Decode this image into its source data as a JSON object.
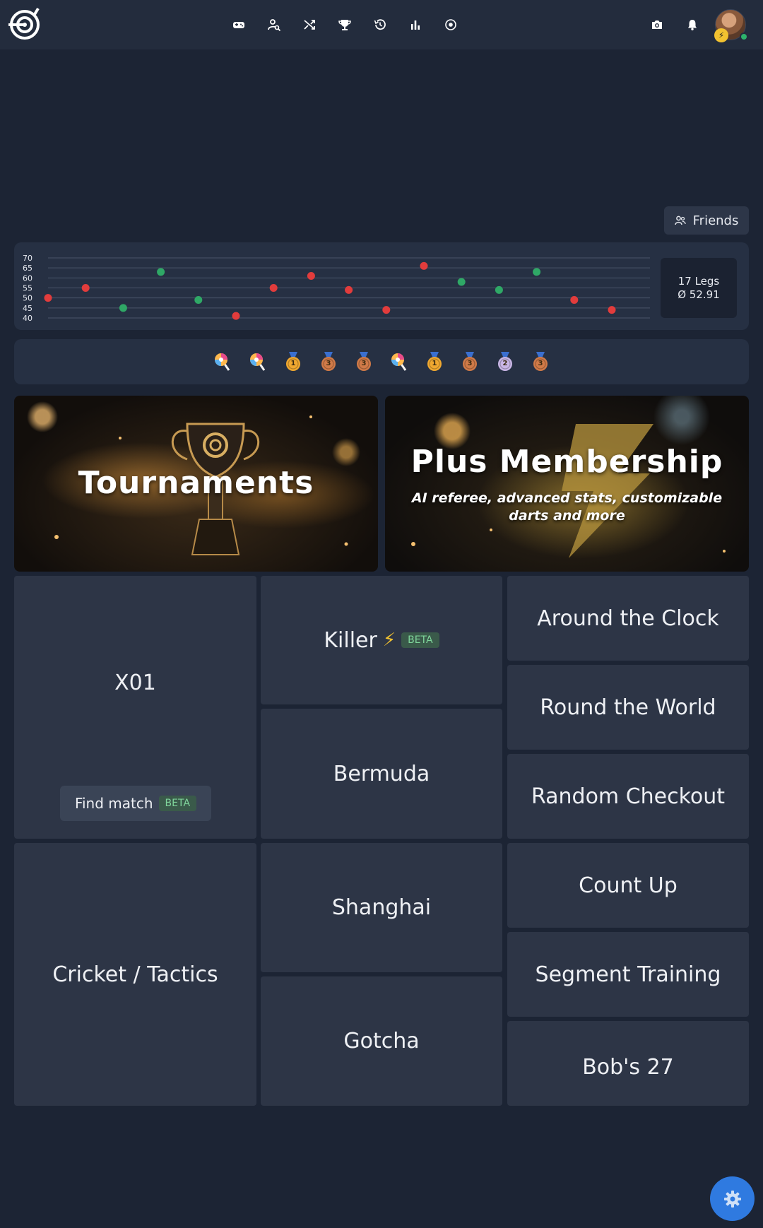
{
  "nav": {
    "icons": [
      "gamepad-icon",
      "user-search-icon",
      "shuffle-icon",
      "trophy-icon",
      "history-icon",
      "bar-chart-icon",
      "record-icon"
    ],
    "right_icons": [
      "camera-icon",
      "bell-icon"
    ]
  },
  "friends": {
    "label": "Friends"
  },
  "stats": {
    "legs": "17 Legs",
    "average": "Ø 52.91"
  },
  "chart_data": {
    "type": "scatter",
    "y_ticks": [
      "70",
      "65",
      "60",
      "55",
      "50",
      "45",
      "40"
    ],
    "ylim": [
      40,
      70
    ],
    "points": [
      {
        "y": 50,
        "result": "loss"
      },
      {
        "y": 55,
        "result": "loss"
      },
      {
        "y": 45,
        "result": "win"
      },
      {
        "y": 63,
        "result": "win"
      },
      {
        "y": 49,
        "result": "win"
      },
      {
        "y": 41,
        "result": "loss"
      },
      {
        "y": 55,
        "result": "loss"
      },
      {
        "y": 61,
        "result": "loss"
      },
      {
        "y": 54,
        "result": "loss"
      },
      {
        "y": 44,
        "result": "loss"
      },
      {
        "y": 66,
        "result": "loss"
      },
      {
        "y": 58,
        "result": "win"
      },
      {
        "y": 54,
        "result": "win"
      },
      {
        "y": 63,
        "result": "win"
      },
      {
        "y": 49,
        "result": "loss"
      },
      {
        "y": 44,
        "result": "loss"
      }
    ],
    "colors": {
      "win": "#2fa866",
      "loss": "#e23c3c"
    },
    "grid": true
  },
  "medals": [
    {
      "icon": "lollipop-icon"
    },
    {
      "icon": "lollipop-icon"
    },
    {
      "icon": "gold-medal-icon",
      "rank": "1"
    },
    {
      "icon": "bronze-medal-icon",
      "rank": "3"
    },
    {
      "icon": "bronze-medal-icon",
      "rank": "3"
    },
    {
      "icon": "lollipop-icon"
    },
    {
      "icon": "gold-medal-icon",
      "rank": "1"
    },
    {
      "icon": "bronze-medal-icon",
      "rank": "3"
    },
    {
      "icon": "silver-medal-icon",
      "rank": "2"
    },
    {
      "icon": "bronze-medal-icon",
      "rank": "3"
    }
  ],
  "banners": {
    "tournaments": {
      "title": "Tournaments"
    },
    "plus": {
      "title": "Plus Membership",
      "subtitle": "AI referee, advanced stats, customizable darts and more"
    }
  },
  "games": {
    "x01": "X01",
    "find_match": "Find match",
    "beta": "BETA",
    "killer": "Killer",
    "killer_beta": "BETA",
    "around_clock": "Around the Clock",
    "round_world": "Round the World",
    "bermuda": "Bermuda",
    "random_checkout": "Random Checkout",
    "cricket": "Cricket / Tactics",
    "shanghai": "Shanghai",
    "count_up": "Count Up",
    "segment_training": "Segment Training",
    "gotcha": "Gotcha",
    "bobs27": "Bob's 27"
  },
  "colors": {
    "background": "#1c2434",
    "panel": "#263043",
    "tile": "#2d3546",
    "accent": "#2f7ae0",
    "beta_green": "#7fd59b"
  }
}
